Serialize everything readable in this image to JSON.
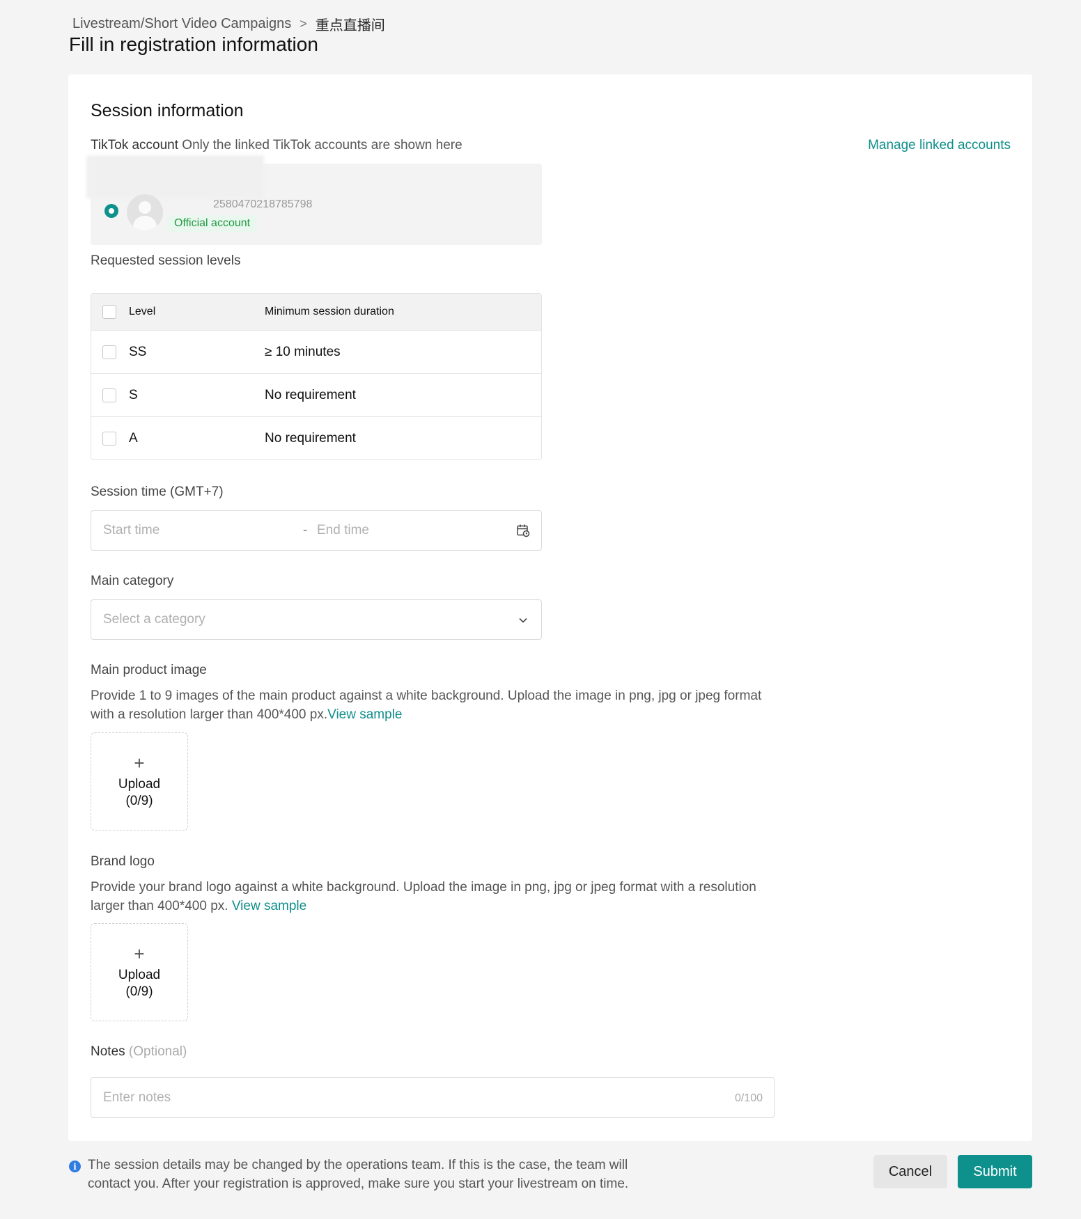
{
  "breadcrumb": {
    "parent": "Livestream/Short Video Campaigns",
    "separator": ">",
    "current": "重点直播间"
  },
  "page_title": "Fill in registration information",
  "session": {
    "title": "Session information",
    "tiktok_label": "TikTok account",
    "tiktok_hint": "Only the linked TikTok accounts are shown here",
    "manage_link": "Manage linked accounts",
    "account": {
      "id": "258047021878579​8",
      "badge": "Official account",
      "selected": true
    },
    "levels_label": "Requested session levels",
    "levels_table": {
      "headers": [
        "Level",
        "Minimum session duration"
      ],
      "rows": [
        {
          "level": "SS",
          "duration": "≥ 10 minutes"
        },
        {
          "level": "S",
          "duration": "No requirement"
        },
        {
          "level": "A",
          "duration": "No requirement"
        }
      ]
    },
    "time_label": "Session time (GMT+7)",
    "start_placeholder": "Start time",
    "range_sep": "-",
    "end_placeholder": "End time",
    "category_label": "Main category",
    "category_placeholder": "Select a category",
    "product_image_label": "Main product image",
    "product_image_desc": "Provide 1 to 9 images of the main product against a white background. Upload the image in png, jpg or jpeg format with a resolution larger than 400*400 px.",
    "product_image_link": "View sample",
    "upload_label": "Upload",
    "upload_count": "(0/9)",
    "brand_logo_label": "Brand logo",
    "brand_logo_desc": "Provide your brand logo against a white background. Upload the image in png, jpg or jpeg format with a resolution larger than 400*400 px.",
    "brand_logo_link": "View sample",
    "logo_upload_label": "Upload",
    "logo_upload_count": "(0/9)",
    "notes_label": "Notes",
    "notes_optional": "(Optional)",
    "notes_placeholder": "Enter notes",
    "notes_count": "0/100"
  },
  "footer": {
    "info_text": "The session details may be changed by the operations team. If this is the case, the team will contact you. After your registration is approved, make sure you start your livestream on time.",
    "cancel": "Cancel",
    "submit": "Submit"
  },
  "colors": {
    "accent": "#0e918c",
    "badge_text": "#1f9a3f",
    "info_icon": "#2f7de1"
  },
  "icons": [
    "chevron-right-icon",
    "calendar-icon",
    "chevron-down-icon",
    "plus-icon",
    "info-icon",
    "avatar-placeholder-icon"
  ]
}
